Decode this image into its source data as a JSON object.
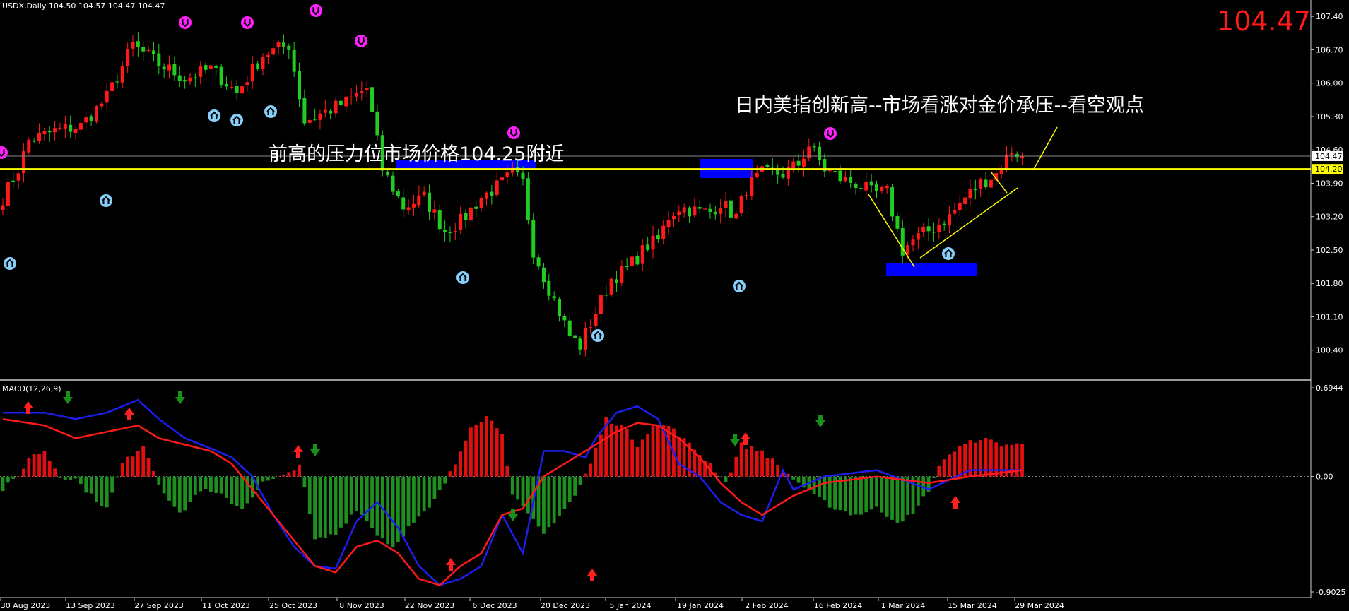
{
  "header": {
    "symbol_info": "USDX,Daily  104.50 104.57 104.47 104.47",
    "big_price": "104.47",
    "macd_label": "MACD(12,26,9)"
  },
  "annotations": {
    "resistance_text": "前高的压力位市场价格104.25附近",
    "headline_text": "日内美指创新高--市场看涨对金价承压--看空观点"
  },
  "colors": {
    "background": "#000000",
    "bull": "#ff1a1a",
    "bear": "#22cc22",
    "macd_line": "#1e1ef0",
    "signal_line": "#ff1a1a",
    "hist_pos": "#e01010",
    "hist_neg": "#1f8f1f",
    "support_line": "#ffff00",
    "zone": "#0000ff",
    "fractal_up": "#ff22ff",
    "fractal_down": "#87cefa",
    "big_price": "#ff1a1a"
  },
  "chart_data": {
    "type": "candlestick",
    "symbol": "USDX",
    "timeframe": "Daily",
    "price_axis": {
      "min": 100.1,
      "max": 107.55,
      "ticks": [
        "107.40",
        "106.70",
        "106.00",
        "105.30",
        "104.60",
        "103.90",
        "103.20",
        "102.50",
        "101.80",
        "101.10",
        "100.40"
      ]
    },
    "current_price": "104.47",
    "support_level": {
      "value": 104.2,
      "label": "104.20"
    },
    "x_axis_labels": [
      "30 Aug 2023",
      "13 Sep 2023",
      "27 Sep 2023",
      "11 Oct 2023",
      "25 Oct 2023",
      "8 Nov 2023",
      "22 Nov 2023",
      "6 Dec 2023",
      "20 Dec 2023",
      "5 Jan 2024",
      "19 Jan 2024",
      "2 Feb 2024",
      "16 Feb 2024",
      "1 Mar 2024",
      "15 Mar 2024",
      "29 Mar 2024"
    ],
    "close_anchors": [
      [
        0,
        103.6
      ],
      [
        3,
        104.2
      ],
      [
        5,
        104.8
      ],
      [
        10,
        105.0
      ],
      [
        15,
        105.1
      ],
      [
        20,
        105.7
      ],
      [
        25,
        106.8
      ],
      [
        30,
        106.4
      ],
      [
        35,
        106.1
      ],
      [
        40,
        106.3
      ],
      [
        45,
        105.8
      ],
      [
        50,
        106.6
      ],
      [
        55,
        106.8
      ],
      [
        58,
        105.2
      ],
      [
        62,
        105.4
      ],
      [
        66,
        105.6
      ],
      [
        70,
        105.9
      ],
      [
        73,
        104.2
      ],
      [
        77,
        103.4
      ],
      [
        81,
        103.6
      ],
      [
        85,
        102.9
      ],
      [
        88,
        103.1
      ],
      [
        92,
        103.6
      ],
      [
        96,
        103.9
      ],
      [
        98,
        104.1
      ],
      [
        100,
        103.9
      ],
      [
        102,
        102.5
      ],
      [
        105,
        101.7
      ],
      [
        109,
        100.7
      ],
      [
        111,
        100.5
      ],
      [
        114,
        101.2
      ],
      [
        117,
        101.9
      ],
      [
        120,
        102.1
      ],
      [
        124,
        102.6
      ],
      [
        126,
        102.7
      ],
      [
        128,
        103.2
      ],
      [
        130,
        103.4
      ],
      [
        134,
        103.3
      ],
      [
        136,
        103.3
      ],
      [
        138,
        103.5
      ],
      [
        141,
        103.2
      ],
      [
        143,
        103.8
      ],
      [
        146,
        104.1
      ],
      [
        150,
        104.1
      ],
      [
        153,
        104.3
      ],
      [
        155,
        104.7
      ],
      [
        158,
        104.2
      ],
      [
        161,
        104.0
      ],
      [
        164,
        103.9
      ],
      [
        167,
        103.7
      ],
      [
        170,
        103.7
      ],
      [
        173,
        102.5
      ],
      [
        175,
        102.7
      ],
      [
        178,
        102.9
      ],
      [
        182,
        103.2
      ],
      [
        185,
        103.6
      ],
      [
        188,
        103.9
      ],
      [
        191,
        104.1
      ],
      [
        194,
        104.6
      ],
      [
        196,
        104.47
      ]
    ],
    "macd_axis": {
      "min": -0.9025,
      "max": 0.6944,
      "ticks": [
        "0.6944",
        "0.00",
        "-0.9025"
      ]
    },
    "macd_histogram_anchors": [
      [
        0,
        -0.1
      ],
      [
        3,
        0.0
      ],
      [
        5,
        0.15
      ],
      [
        8,
        0.2
      ],
      [
        11,
        0.0
      ],
      [
        14,
        -0.02
      ],
      [
        17,
        -0.15
      ],
      [
        20,
        -0.25
      ],
      [
        23,
        0.1
      ],
      [
        27,
        0.25
      ],
      [
        30,
        -0.05
      ],
      [
        34,
        -0.3
      ],
      [
        38,
        -0.1
      ],
      [
        42,
        -0.15
      ],
      [
        46,
        -0.25
      ],
      [
        50,
        -0.05
      ],
      [
        54,
        0.0
      ],
      [
        57,
        0.1
      ],
      [
        60,
        -0.5
      ],
      [
        64,
        -0.45
      ],
      [
        68,
        -0.25
      ],
      [
        72,
        -0.45
      ],
      [
        75,
        -0.55
      ],
      [
        78,
        -0.4
      ],
      [
        82,
        -0.25
      ],
      [
        85,
        -0.05
      ],
      [
        87,
        0.1
      ],
      [
        90,
        0.4
      ],
      [
        93,
        0.47
      ],
      [
        96,
        0.35
      ],
      [
        98,
        -0.15
      ],
      [
        101,
        -0.3
      ],
      [
        104,
        -0.45
      ],
      [
        107,
        -0.3
      ],
      [
        110,
        -0.15
      ],
      [
        113,
        0.1
      ],
      [
        116,
        0.45
      ],
      [
        119,
        0.4
      ],
      [
        122,
        0.25
      ],
      [
        125,
        0.4
      ],
      [
        128,
        0.4
      ],
      [
        132,
        0.25
      ],
      [
        136,
        0.1
      ],
      [
        139,
        -0.05
      ],
      [
        142,
        0.25
      ],
      [
        146,
        0.2
      ],
      [
        150,
        0.05
      ],
      [
        153,
        -0.05
      ],
      [
        156,
        -0.15
      ],
      [
        160,
        -0.25
      ],
      [
        164,
        -0.3
      ],
      [
        168,
        -0.25
      ],
      [
        172,
        -0.35
      ],
      [
        175,
        -0.3
      ],
      [
        178,
        -0.1
      ],
      [
        181,
        0.15
      ],
      [
        185,
        0.25
      ],
      [
        188,
        0.3
      ],
      [
        192,
        0.25
      ],
      [
        196,
        0.25
      ]
    ],
    "macd_line_anchors": [
      [
        0,
        0.5
      ],
      [
        8,
        0.5
      ],
      [
        14,
        0.45
      ],
      [
        20,
        0.5
      ],
      [
        26,
        0.6
      ],
      [
        30,
        0.45
      ],
      [
        35,
        0.3
      ],
      [
        40,
        0.22
      ],
      [
        44,
        0.15
      ],
      [
        48,
        0.0
      ],
      [
        52,
        -0.3
      ],
      [
        56,
        -0.55
      ],
      [
        60,
        -0.7
      ],
      [
        64,
        -0.72
      ],
      [
        68,
        -0.35
      ],
      [
        72,
        -0.2
      ],
      [
        76,
        -0.4
      ],
      [
        80,
        -0.7
      ],
      [
        84,
        -0.85
      ],
      [
        88,
        -0.8
      ],
      [
        92,
        -0.7
      ],
      [
        96,
        -0.3
      ],
      [
        100,
        -0.6
      ],
      [
        104,
        0.2
      ],
      [
        108,
        0.2
      ],
      [
        112,
        0.15
      ],
      [
        114,
        0.3
      ],
      [
        118,
        0.5
      ],
      [
        122,
        0.55
      ],
      [
        126,
        0.45
      ],
      [
        130,
        0.1
      ],
      [
        134,
        0.0
      ],
      [
        138,
        -0.2
      ],
      [
        142,
        -0.3
      ],
      [
        146,
        -0.35
      ],
      [
        150,
        0.05
      ],
      [
        152,
        -0.1
      ],
      [
        158,
        0.0
      ],
      [
        168,
        0.05
      ],
      [
        178,
        -0.1
      ],
      [
        186,
        0.05
      ],
      [
        196,
        0.05
      ]
    ],
    "signal_line_anchors": [
      [
        0,
        0.45
      ],
      [
        8,
        0.4
      ],
      [
        14,
        0.3
      ],
      [
        20,
        0.35
      ],
      [
        26,
        0.4
      ],
      [
        30,
        0.3
      ],
      [
        35,
        0.25
      ],
      [
        40,
        0.2
      ],
      [
        44,
        0.1
      ],
      [
        48,
        -0.1
      ],
      [
        52,
        -0.3
      ],
      [
        56,
        -0.5
      ],
      [
        60,
        -0.7
      ],
      [
        64,
        -0.75
      ],
      [
        68,
        -0.55
      ],
      [
        72,
        -0.5
      ],
      [
        76,
        -0.6
      ],
      [
        80,
        -0.8
      ],
      [
        84,
        -0.85
      ],
      [
        88,
        -0.7
      ],
      [
        92,
        -0.6
      ],
      [
        96,
        -0.3
      ],
      [
        100,
        -0.25
      ],
      [
        104,
        0.0
      ],
      [
        108,
        0.1
      ],
      [
        112,
        0.2
      ],
      [
        114,
        0.25
      ],
      [
        118,
        0.35
      ],
      [
        122,
        0.42
      ],
      [
        126,
        0.4
      ],
      [
        130,
        0.3
      ],
      [
        134,
        0.15
      ],
      [
        138,
        -0.05
      ],
      [
        142,
        -0.2
      ],
      [
        146,
        -0.3
      ],
      [
        150,
        -0.2
      ],
      [
        152,
        -0.15
      ],
      [
        158,
        -0.05
      ],
      [
        168,
        0.0
      ],
      [
        178,
        -0.05
      ],
      [
        186,
        0.0
      ],
      [
        196,
        0.05
      ]
    ]
  }
}
